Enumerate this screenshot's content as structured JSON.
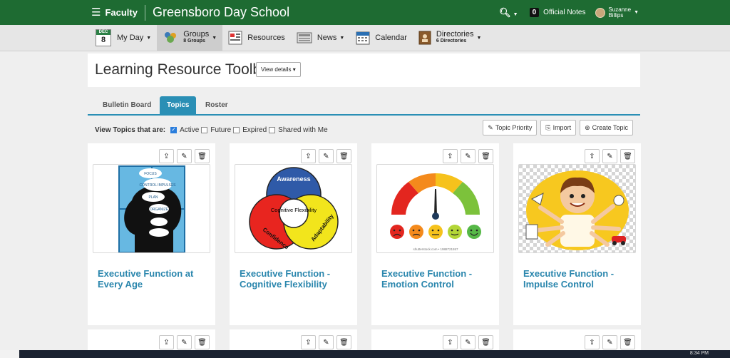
{
  "topbar": {
    "menu_label": "Faculty",
    "school_name": "Greensboro Day School",
    "notes_count": "0",
    "notes_label": "Official Notes",
    "user_first": "Suzanne",
    "user_last": "Billips",
    "brand_color": "#1e6b32"
  },
  "nav": {
    "myday": {
      "cal_month": "DEC",
      "cal_day": "8",
      "label": "My Day"
    },
    "groups": {
      "label": "Groups",
      "sub": "8 Groups"
    },
    "resources": {
      "label": "Resources"
    },
    "news": {
      "label": "News"
    },
    "calendar": {
      "label": "Calendar"
    },
    "directories": {
      "label": "Directories",
      "sub": "6 Directories"
    }
  },
  "page": {
    "title": "Learning Resource Toolbox",
    "view_details": "View details"
  },
  "tabs": [
    "Bulletin Board",
    "Topics",
    "Roster"
  ],
  "active_tab": "Topics",
  "filter": {
    "label": "View Topics that are:",
    "options": [
      {
        "label": "Active",
        "checked": true
      },
      {
        "label": "Future",
        "checked": false
      },
      {
        "label": "Expired",
        "checked": false
      },
      {
        "label": "Shared with Me",
        "checked": false
      }
    ]
  },
  "actions": {
    "topic_priority": "Topic Priority",
    "import": "Import",
    "create_topic": "Create Topic"
  },
  "cards": [
    {
      "title": "Executive Function at Every Age",
      "image": "child-head-silhouette"
    },
    {
      "title": "Executive Function - Cognitive Flexibility",
      "image": "venn-diagram",
      "venn_labels": [
        "Awareness",
        "Cognitive Flexibility",
        "Confidence",
        "Adaptability"
      ]
    },
    {
      "title": "Executive Function - Emotion Control",
      "image": "emotion-gauge",
      "caption": "shutterstock.com • 1988721557"
    },
    {
      "title": "Executive Function - Impulse Control",
      "image": "multitasking-cartoon"
    }
  ],
  "image_text": {
    "card1_bubbles": [
      "FOCUS",
      "CONTROL IMPULSES",
      "PLAN",
      "ORGANIZE"
    ]
  },
  "taskbar": {
    "clock": "8:34 PM"
  }
}
